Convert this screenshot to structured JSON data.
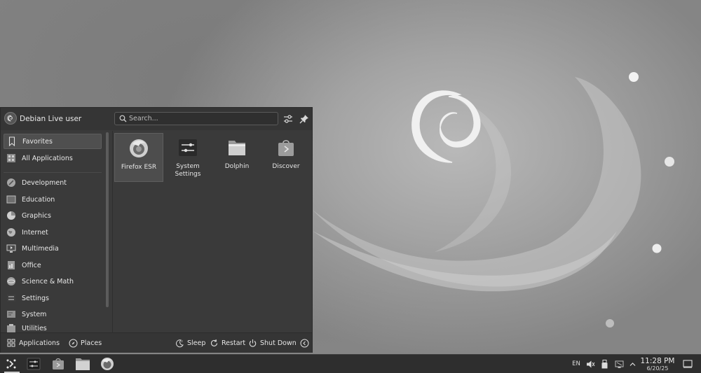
{
  "launcher": {
    "username": "Debian Live user",
    "search_placeholder": "Search...",
    "categories": [
      {
        "label": "Favorites",
        "icon": "bookmark-icon"
      },
      {
        "label": "All Applications",
        "icon": "grid-icon"
      },
      {
        "label": "Development",
        "icon": "development-icon"
      },
      {
        "label": "Education",
        "icon": "education-icon"
      },
      {
        "label": "Graphics",
        "icon": "graphics-icon"
      },
      {
        "label": "Internet",
        "icon": "globe-icon"
      },
      {
        "label": "Multimedia",
        "icon": "multimedia-icon"
      },
      {
        "label": "Office",
        "icon": "office-icon"
      },
      {
        "label": "Science & Math",
        "icon": "science-icon"
      },
      {
        "label": "Settings",
        "icon": "settings-icon"
      },
      {
        "label": "System",
        "icon": "system-icon"
      },
      {
        "label": "Utilities",
        "icon": "utilities-icon"
      }
    ],
    "selected_category": "Favorites",
    "favorites": [
      {
        "label": "Firefox ESR",
        "icon": "firefox-icon"
      },
      {
        "label": "System Settings",
        "icon": "system-settings-icon"
      },
      {
        "label": "Dolphin",
        "icon": "folder-icon"
      },
      {
        "label": "Discover",
        "icon": "discover-icon"
      }
    ],
    "footer": {
      "applications": "Applications",
      "places": "Places",
      "sleep": "Sleep",
      "restart": "Restart",
      "shutdown": "Shut Down"
    }
  },
  "taskbar": {
    "apps": [
      "application-launcher-icon",
      "system-settings-icon",
      "discover-icon",
      "folder-icon",
      "firefox-icon"
    ],
    "tray": {
      "keyboard_layout": "EN",
      "time": "11:28 PM",
      "date": "6/20/25"
    }
  }
}
